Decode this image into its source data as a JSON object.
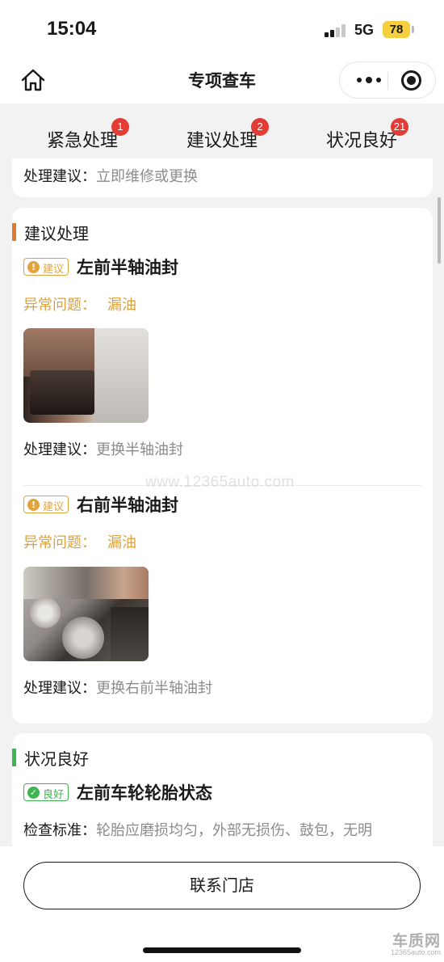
{
  "status_bar": {
    "time": "15:04",
    "network": "5G",
    "battery": "78"
  },
  "nav": {
    "title": "专项查车"
  },
  "tabs": [
    {
      "label": "紧急处理",
      "badge": "1"
    },
    {
      "label": "建议处理",
      "badge": "2"
    },
    {
      "label": "状况良好",
      "badge": "21"
    }
  ],
  "urgent_card": {
    "advice_label": "处理建议：",
    "advice_value": "立即维修或更换"
  },
  "suggest_section": {
    "title": "建议处理",
    "accent_color": "#e07a2e",
    "items": [
      {
        "tag": "建议",
        "name": "左前半轴油封",
        "issue_label": "异常问题：",
        "issue_value": "漏油",
        "advice_label": "处理建议：",
        "advice_value": "更换半轴油封"
      },
      {
        "tag": "建议",
        "name": "右前半轴油封",
        "issue_label": "异常问题：",
        "issue_value": "漏油",
        "advice_label": "处理建议：",
        "advice_value": "更换右前半轴油封"
      }
    ]
  },
  "good_section": {
    "title": "状况良好",
    "accent_color": "#3fb552",
    "items": [
      {
        "tag": "良好",
        "name": "左前车轮轮胎状态",
        "standard_label": "检查标准：",
        "standard_value": "轮胎应磨损均匀，外部无损伤、鼓包，无明"
      }
    ]
  },
  "watermark": "www.12365auto.com",
  "bottom": {
    "contact_label": "联系门店"
  },
  "logo": {
    "name": "车质网",
    "url": "12365auto.com"
  }
}
